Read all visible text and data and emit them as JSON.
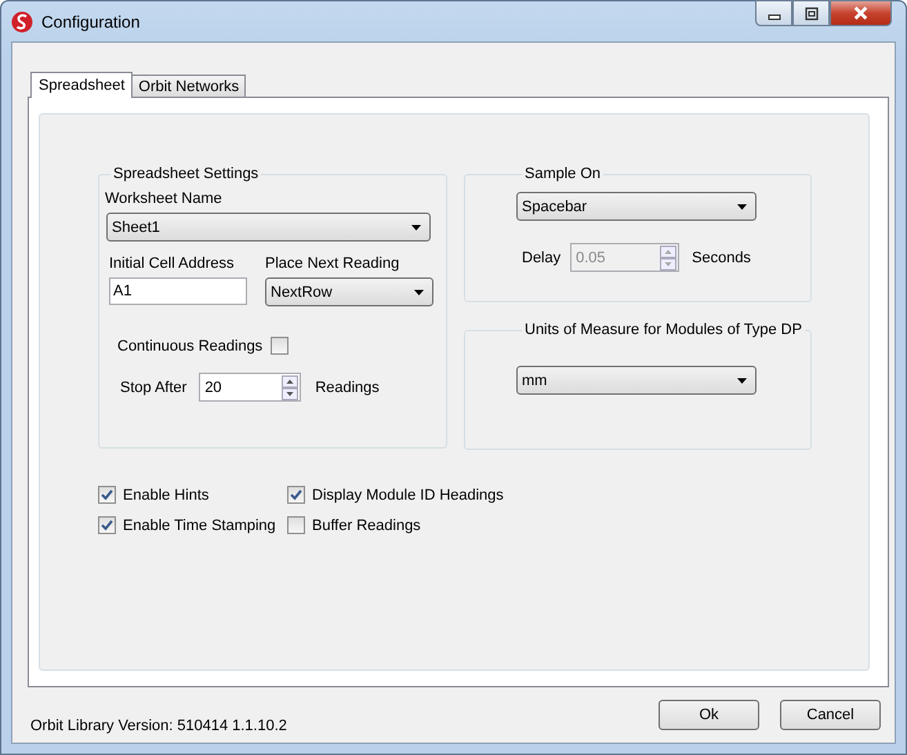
{
  "window": {
    "title": "Configuration"
  },
  "tabs": [
    {
      "label": "Spreadsheet",
      "selected": true
    },
    {
      "label": "Orbit Networks",
      "selected": false
    }
  ],
  "spreadsheet_settings": {
    "title": "Spreadsheet Settings",
    "worksheet_name": {
      "label": "Worksheet Name",
      "value": "Sheet1"
    },
    "initial_cell_address": {
      "label": "Initial Cell Address",
      "value": "A1"
    },
    "place_next_reading": {
      "label": "Place Next Reading",
      "value": "NextRow"
    },
    "continuous_readings": {
      "label": "Continuous Readings",
      "checked": false
    },
    "stop_after": {
      "label": "Stop After",
      "value": "20",
      "unit": "Readings"
    }
  },
  "sample_on": {
    "title": "Sample On",
    "value": "Spacebar",
    "delay": {
      "label": "Delay",
      "value": "0.05",
      "unit": "Seconds",
      "disabled": true
    }
  },
  "units_of_measure": {
    "title": "Units of Measure for Modules of Type DP",
    "value": "mm"
  },
  "options": [
    {
      "label": "Enable Hints",
      "checked": true
    },
    {
      "label": "Display Module ID Headings",
      "checked": true
    },
    {
      "label": "Enable Time Stamping",
      "checked": true
    },
    {
      "label": "Buffer Readings",
      "checked": false
    }
  ],
  "status": "Orbit Library Version: 510414 1.1.10.2",
  "buttons": [
    {
      "label": "Ok"
    },
    {
      "label": "Cancel"
    }
  ]
}
